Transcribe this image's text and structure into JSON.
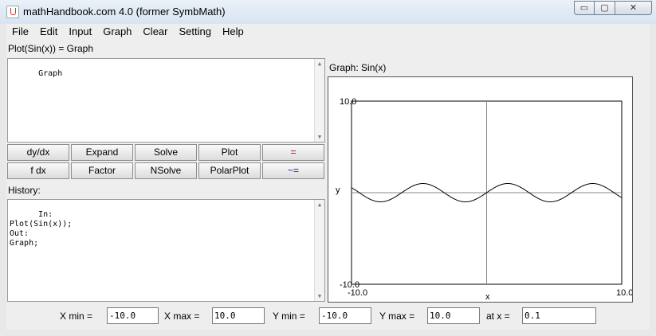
{
  "window": {
    "title": "mathHandbook.com 4.0 (former SymbMath)"
  },
  "window_controls": {
    "minimize": "▭",
    "maximize": "▢",
    "close": "✕"
  },
  "menu": [
    "File",
    "Edit",
    "Input",
    "Graph",
    "Clear",
    "Setting",
    "Help"
  ],
  "expression_label": "Plot(Sin(x)) = Graph",
  "output_text": "Graph",
  "buttons": {
    "row1": [
      "dy/dx",
      "Expand",
      "Solve",
      "Plot",
      "="
    ],
    "row2": [
      "f dx",
      "Factor",
      "NSolve",
      "PolarPlot",
      "~="
    ]
  },
  "colors": {
    "equals_button": "#cc0000",
    "approx_button": "#1a1aa0"
  },
  "history_label": "History:",
  "history_text": "In:\nPlot(Sin(x));\nOut:\nGraph;",
  "graph": {
    "title": "Graph: Sin(x)",
    "ytop": "10.0",
    "ybottom": "-10.0",
    "xleft": "-10.0",
    "xright": "10.0",
    "xlabel": "x",
    "ylabel": "y"
  },
  "chart_data": {
    "type": "line",
    "function": "sin(x)",
    "xlim": [
      -10,
      10
    ],
    "ylim": [
      -10,
      10
    ],
    "series": [
      {
        "name": "Sin(x)",
        "x_range": [
          -10,
          10
        ]
      }
    ],
    "title": "Graph: Sin(x)",
    "xlabel": "x",
    "ylabel": "y",
    "grid": false
  },
  "range": {
    "xmin_label": "X min =",
    "xmin": "-10.0",
    "xmax_label": "X max =",
    "xmax": "10.0",
    "ymin_label": "Y min =",
    "ymin": "-10.0",
    "ymax_label": "Y max =",
    "ymax": "10.0",
    "atx_label": "at x =",
    "atx": "0.1"
  }
}
